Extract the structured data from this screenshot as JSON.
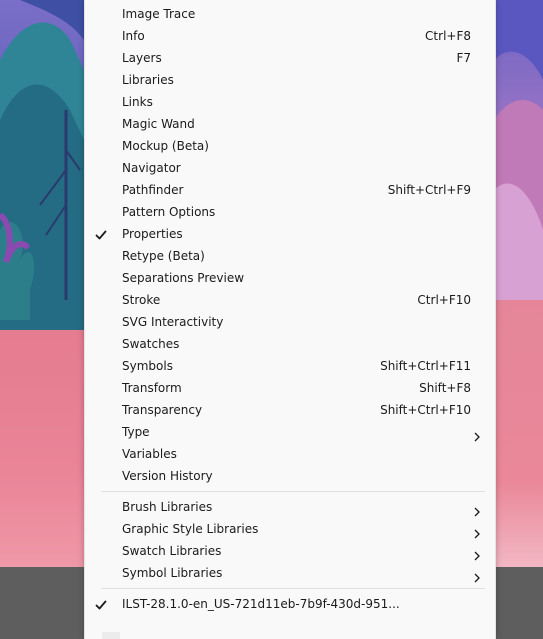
{
  "menu": {
    "items": [
      {
        "label": "Image Trace",
        "shortcut": "",
        "checked": false,
        "submenu": false
      },
      {
        "label": "Info",
        "shortcut": "Ctrl+F8",
        "checked": false,
        "submenu": false
      },
      {
        "label": "Layers",
        "shortcut": "F7",
        "checked": false,
        "submenu": false
      },
      {
        "label": "Libraries",
        "shortcut": "",
        "checked": false,
        "submenu": false
      },
      {
        "label": "Links",
        "shortcut": "",
        "checked": false,
        "submenu": false
      },
      {
        "label": "Magic Wand",
        "shortcut": "",
        "checked": false,
        "submenu": false
      },
      {
        "label": "Mockup (Beta)",
        "shortcut": "",
        "checked": false,
        "submenu": false
      },
      {
        "label": "Navigator",
        "shortcut": "",
        "checked": false,
        "submenu": false
      },
      {
        "label": "Pathfinder",
        "shortcut": "Shift+Ctrl+F9",
        "checked": false,
        "submenu": false
      },
      {
        "label": "Pattern Options",
        "shortcut": "",
        "checked": false,
        "submenu": false
      },
      {
        "label": "Properties",
        "shortcut": "",
        "checked": true,
        "submenu": false
      },
      {
        "label": "Retype (Beta)",
        "shortcut": "",
        "checked": false,
        "submenu": false
      },
      {
        "label": "Separations Preview",
        "shortcut": "",
        "checked": false,
        "submenu": false
      },
      {
        "label": "Stroke",
        "shortcut": "Ctrl+F10",
        "checked": false,
        "submenu": false
      },
      {
        "label": "SVG Interactivity",
        "shortcut": "",
        "checked": false,
        "submenu": false
      },
      {
        "label": "Swatches",
        "shortcut": "",
        "checked": false,
        "submenu": false
      },
      {
        "label": "Symbols",
        "shortcut": "Shift+Ctrl+F11",
        "checked": false,
        "submenu": false
      },
      {
        "label": "Transform",
        "shortcut": "Shift+F8",
        "checked": false,
        "submenu": false
      },
      {
        "label": "Transparency",
        "shortcut": "Shift+Ctrl+F10",
        "checked": false,
        "submenu": false
      },
      {
        "label": "Type",
        "shortcut": "",
        "checked": false,
        "submenu": true
      },
      {
        "label": "Variables",
        "shortcut": "",
        "checked": false,
        "submenu": false
      },
      {
        "label": "Version History",
        "shortcut": "",
        "checked": false,
        "submenu": false
      }
    ],
    "libraries": [
      {
        "label": "Brush Libraries",
        "submenu": true
      },
      {
        "label": "Graphic Style Libraries",
        "submenu": true
      },
      {
        "label": "Swatch Libraries",
        "submenu": true
      },
      {
        "label": "Symbol Libraries",
        "submenu": true
      }
    ],
    "documents": [
      {
        "label": "ILST-28.1.0-en_US-721d11eb-7b9f-430d-951...",
        "checked": true
      }
    ]
  },
  "icons": {
    "check": "checkmark-icon",
    "submenu": "chevron-right-icon"
  },
  "colors": {
    "menu_bg": "#f9f9f9",
    "text": "#1b1b1b",
    "ground": "#e57c90",
    "sky": "#5e5fb8"
  }
}
